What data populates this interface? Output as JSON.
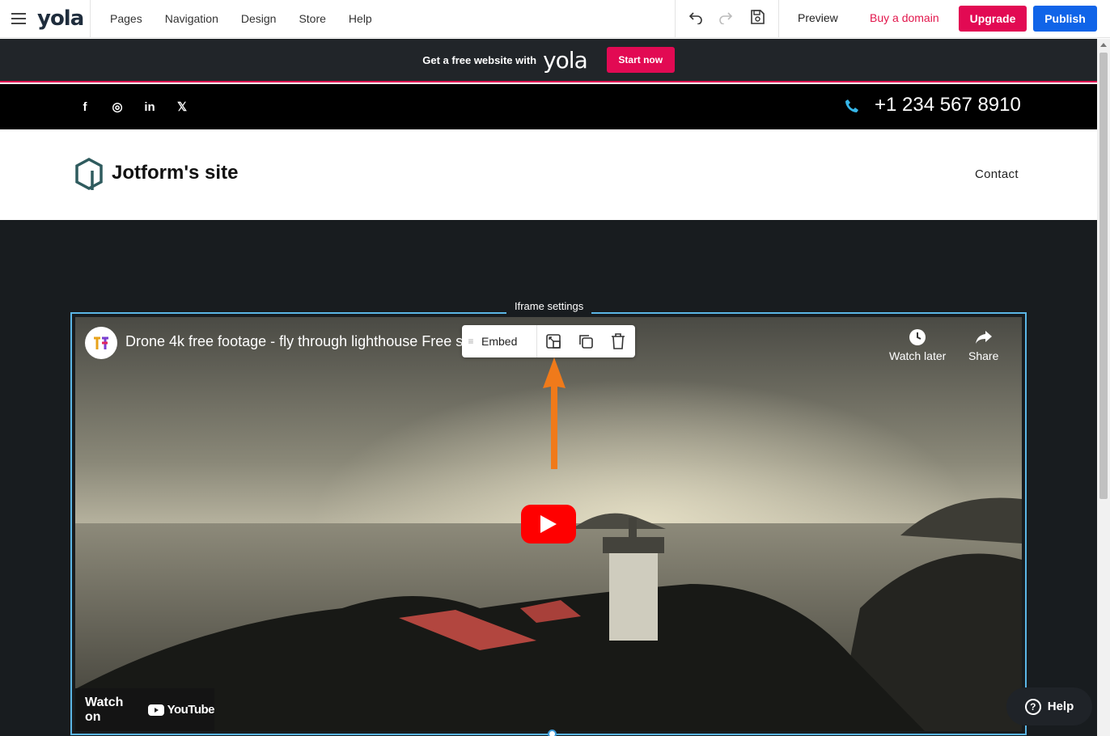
{
  "editor": {
    "logo": "yola",
    "nav": [
      "Pages",
      "Navigation",
      "Design",
      "Store",
      "Help"
    ],
    "preview_label": "Preview",
    "buy_domain_label": "Buy a domain",
    "upgrade_label": "Upgrade",
    "publish_label": "Publish",
    "icons": [
      "menu-icon",
      "undo-icon",
      "redo-icon",
      "save-icon"
    ]
  },
  "promo": {
    "text": "Get a free website with",
    "logo": "yola",
    "button_label": "Start now"
  },
  "social_bar": {
    "icons": [
      {
        "name": "facebook-icon",
        "glyph": "f"
      },
      {
        "name": "instagram-icon",
        "glyph": "◎"
      },
      {
        "name": "linkedin-icon",
        "glyph": "in"
      },
      {
        "name": "x-icon",
        "glyph": "𝕏"
      }
    ],
    "phone": "+1 234 567 8910"
  },
  "site_header": {
    "title": "Jotform's site",
    "nav_contact": "Contact"
  },
  "iframe": {
    "settings_label": "Iframe settings",
    "video_title": "Drone 4k free footage - fly through lighthouse Free st",
    "watch_later": "Watch later",
    "share": "Share",
    "watch_on": "Watch on",
    "youtube": "YouTube"
  },
  "floating_toolbar": {
    "embed_label": "Embed",
    "drag_glyph": "≡",
    "buttons": [
      "iframe-settings-icon",
      "duplicate-icon",
      "delete-icon"
    ]
  },
  "help_button": {
    "label": "Help",
    "glyph": "?"
  },
  "colors": {
    "brand_pink": "#e20a53",
    "publish_blue": "#1064e8",
    "selection_blue": "#5bb6e6",
    "arrow_orange": "#f07a1a"
  }
}
